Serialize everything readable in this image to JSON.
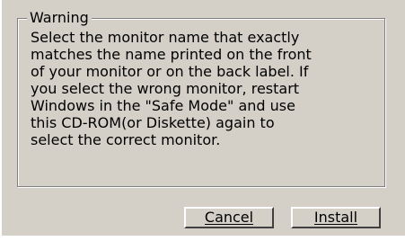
{
  "dialog": {
    "group_label": "Warning",
    "message": "Select the monitor name that exactly\nmatches the name printed on the front\nof your monitor or on the back label. If\nyou select the wrong monitor, restart\nWindows in the \"Safe Mode\" and use\nthis CD-ROM(or Diskette) again to\nselect the correct monitor.",
    "buttons": {
      "cancel_label": "Cancel",
      "install_label": "Install"
    }
  },
  "colors": {
    "dialog_background": "#d4d0c8",
    "text": "#000000"
  }
}
